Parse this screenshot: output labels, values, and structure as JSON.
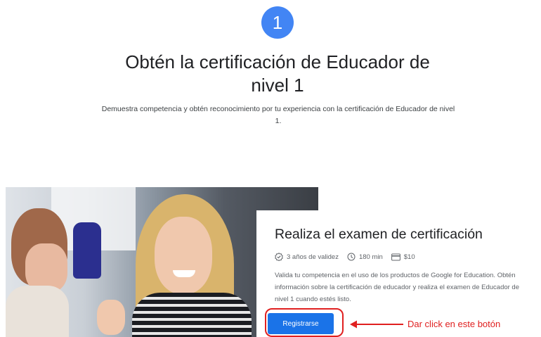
{
  "step": {
    "number": "1",
    "color": "#4285f4"
  },
  "header": {
    "title": "Obtén la certificación de Educador de nivel 1",
    "description": "Demuestra competencia y obtén reconocimiento por tu experiencia con la certificación de Educador de nivel 1."
  },
  "card": {
    "title": "Realiza el examen de certificación",
    "meta": {
      "validity": "3 años de validez",
      "duration": "180 min",
      "price": "$10"
    },
    "description": "Valida tu competencia en el uso de los productos de Google for Education. Obtén información sobre la certificación de educador y realiza el examen de Educador de nivel 1 cuando estés listo.",
    "button_label": "Registrarse",
    "button_color": "#1a73e8"
  },
  "annotation": {
    "text": "Dar click en este botón",
    "color": "#e02020"
  },
  "icons": [
    "verified-badge-icon",
    "clock-icon",
    "credit-card-icon",
    "arrow-left-icon"
  ]
}
